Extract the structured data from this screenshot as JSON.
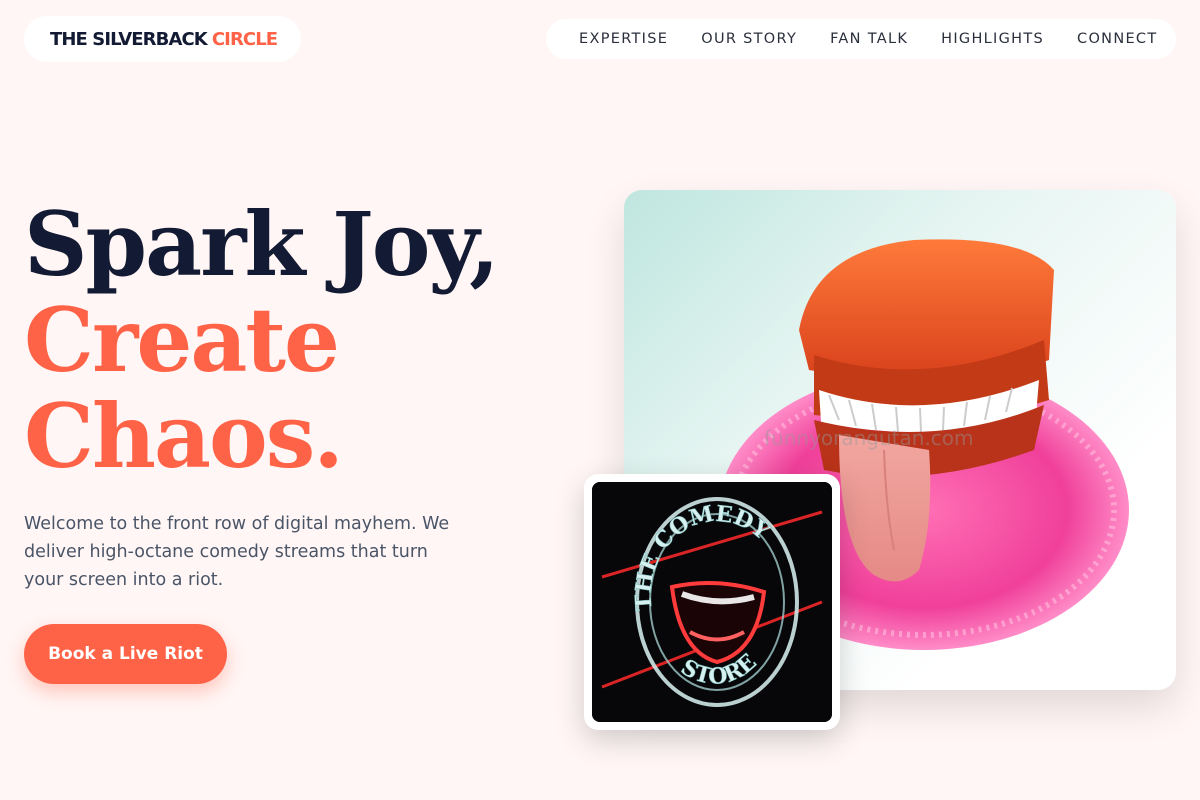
{
  "brand": {
    "name_dark": "THE SILVERBACK",
    "name_accent": "CIRCLE",
    "accent_color": "#ff6347",
    "dark_color": "#131a33"
  },
  "nav": {
    "items": [
      {
        "label": "EXPERTISE"
      },
      {
        "label": "OUR STORY"
      },
      {
        "label": "FAN TALK"
      },
      {
        "label": "HIGHLIGHTS"
      },
      {
        "label": "CONNECT"
      }
    ]
  },
  "hero": {
    "headline_line1": "Spark Joy,",
    "headline_line2": "Create",
    "headline_line3": "Chaos.",
    "intro": "Welcome to the front row of digital mayhem. We deliver high-octane comedy streams that turn your screen into a riot.",
    "cta_label": "Book a Live Riot"
  },
  "images": {
    "main_icon": "wind-up-chattering-teeth-photo",
    "inset_icon": "comedy-store-neon-sign-photo",
    "inset_sign_text_top": "THE COMEDY",
    "inset_sign_text_bottom": "STORE",
    "watermark_text": "funnyorangutan.com"
  }
}
